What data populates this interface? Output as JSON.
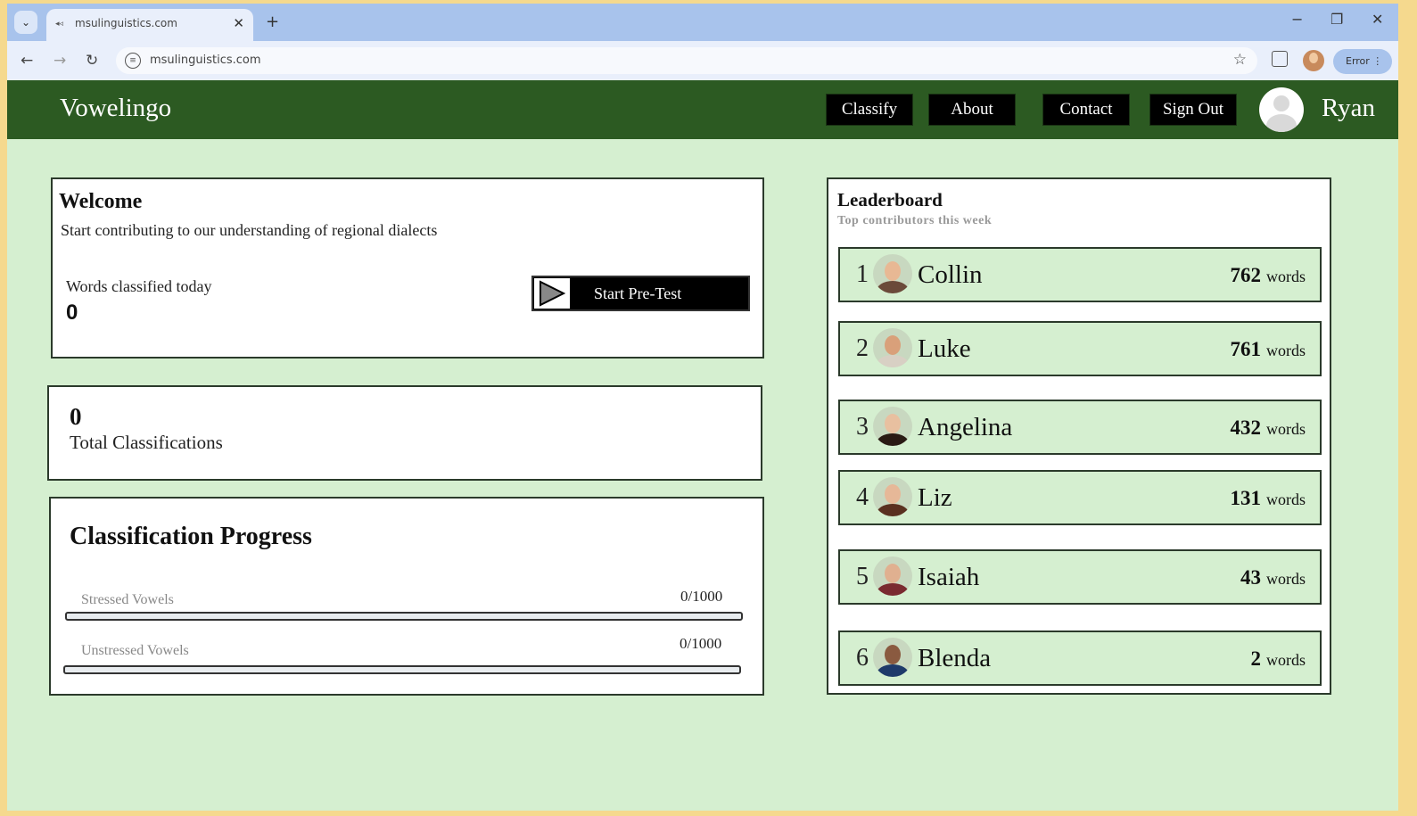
{
  "browser": {
    "tab_title": "msulinguistics.com",
    "tab_favicon": "◂◃",
    "url": "msulinguistics.com",
    "error_chip": "Error"
  },
  "app": {
    "brand": "Vowelingo",
    "nav": [
      "Classify",
      "About",
      "Contact",
      "Sign Out"
    ],
    "username": "Ryan",
    "accent_color": "#2c5a22",
    "background_color": "#d5efd0"
  },
  "welcome": {
    "title": "Welcome",
    "subtitle": "Start contributing to our understanding of regional  dialects",
    "words_label": "Words classified  today",
    "words_value": "0",
    "pretest_button": "Start Pre-Test",
    "pretest_icon": "play-icon"
  },
  "totals": {
    "value": "0",
    "label": "Total Classifications"
  },
  "progress": {
    "title": "Classification Progress",
    "bars": [
      {
        "label": "Stressed Vowels",
        "count": "0/1000",
        "fraction": 0
      },
      {
        "label": "Unstressed Vowels",
        "count": "0/1000",
        "fraction": 0
      }
    ]
  },
  "leaderboard": {
    "title": "Leaderboard",
    "subtitle": "Top contributors this week",
    "unit": "words",
    "entries": [
      {
        "rank": "1",
        "name": "Collin",
        "count": "762",
        "avatar_color": "#6b4a3a",
        "face_color": "#e8b894"
      },
      {
        "rank": "2",
        "name": "Luke",
        "count": "761",
        "avatar_color": "#d8d0c4",
        "face_color": "#d9a07a"
      },
      {
        "rank": "3",
        "name": "Angelina",
        "count": "432",
        "avatar_color": "#2a1a14",
        "face_color": "#e8c0a0"
      },
      {
        "rank": "4",
        "name": "Liz",
        "count": "131",
        "avatar_color": "#5a3020",
        "face_color": "#e6b898"
      },
      {
        "rank": "5",
        "name": "Isaiah",
        "count": "43",
        "avatar_color": "#7a2a30",
        "face_color": "#e0b090"
      },
      {
        "rank": "6",
        "name": "Blenda",
        "count": "2",
        "avatar_color": "#1e3a6a",
        "face_color": "#8a5a40"
      }
    ]
  }
}
